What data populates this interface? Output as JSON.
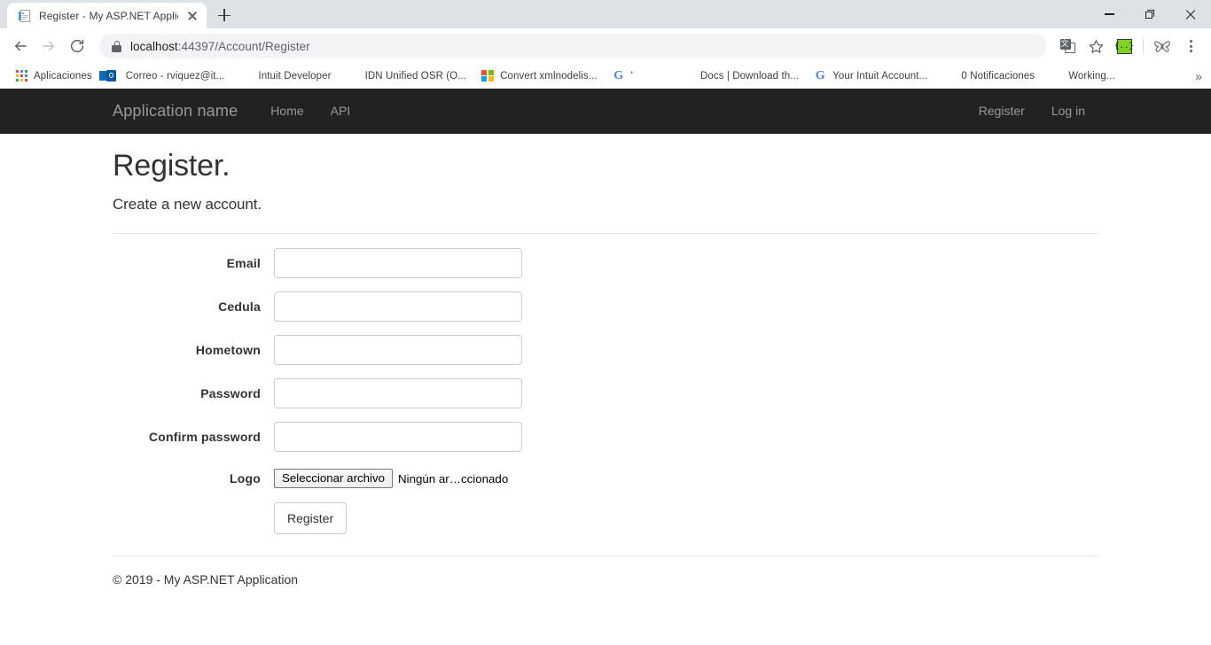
{
  "browser": {
    "tab": {
      "title": "Register - My ASP.NET Applicatio",
      "favicon": "document-icon",
      "close_icon": "close-icon"
    },
    "new_tab_label": "+",
    "window_controls": {
      "minimize": "minimize-icon",
      "restore": "restore-icon",
      "close": "close-icon"
    },
    "nav": {
      "back": "back-arrow-icon",
      "forward": "forward-arrow-icon",
      "reload": "reload-icon"
    },
    "omnibox": {
      "lock_icon": "lock-icon",
      "host": "localhost",
      "path": ":44397/Account/Register",
      "full_url": "localhost:44397/Account/Register"
    },
    "toolbar_icons": [
      {
        "name": "translate-icon"
      },
      {
        "name": "bookmark-star-icon"
      },
      {
        "name": "extension-json-viewer-icon",
        "label": "{..}"
      },
      {
        "name": "extension-butterfly-icon"
      },
      {
        "name": "chrome-menu-icon"
      }
    ],
    "bookmarks": [
      {
        "label": "Aplicaciones",
        "icon": "apps-grid-icon"
      },
      {
        "label": "Correo - rviquez@it...",
        "icon": "outlook-icon"
      },
      {
        "label": "Intuit Developer",
        "icon": "blue-circle-icon",
        "color": "#2a5fd6"
      },
      {
        "label": "IDN Unified OSR (O...",
        "icon": "globe-icon"
      },
      {
        "label": "Convert xmlnodelis...",
        "icon": "microsoft-icon"
      },
      {
        "label": "'",
        "icon": "google-icon"
      },
      {
        "label": "",
        "icon": "facebook-icon"
      },
      {
        "label": "Docs | Download th...",
        "icon": "blue-circle-icon",
        "color": "#1b8fe0"
      },
      {
        "label": "Your Intuit Account...",
        "icon": "google-icon"
      },
      {
        "label": "0 Notificaciones",
        "icon": "facebook-icon"
      },
      {
        "label": "Working...",
        "icon": "globe-icon"
      }
    ],
    "bookmarks_overflow": "»"
  },
  "site": {
    "navbar": {
      "brand": "Application name",
      "links": [
        {
          "label": "Home"
        },
        {
          "label": "API"
        }
      ],
      "right_links": [
        {
          "label": "Register"
        },
        {
          "label": "Log in"
        }
      ],
      "background": "#222222",
      "link_color": "#999999"
    },
    "page": {
      "title": "Register.",
      "subtitle": "Create a new account."
    },
    "form": {
      "fields": [
        {
          "label": "Email",
          "type": "text",
          "value": "",
          "placeholder": ""
        },
        {
          "label": "Cedula",
          "type": "text",
          "value": "",
          "placeholder": ""
        },
        {
          "label": "Hometown",
          "type": "text",
          "value": "",
          "placeholder": ""
        },
        {
          "label": "Password",
          "type": "password",
          "value": "",
          "placeholder": ""
        },
        {
          "label": "Confirm password",
          "type": "password",
          "value": "",
          "placeholder": ""
        }
      ],
      "file_field": {
        "label": "Logo",
        "button_label": "Seleccionar archivo",
        "status_text": "Ningún ar…ccionado"
      },
      "submit_label": "Register"
    },
    "footer": {
      "text": "© 2019 - My ASP.NET Application"
    }
  }
}
